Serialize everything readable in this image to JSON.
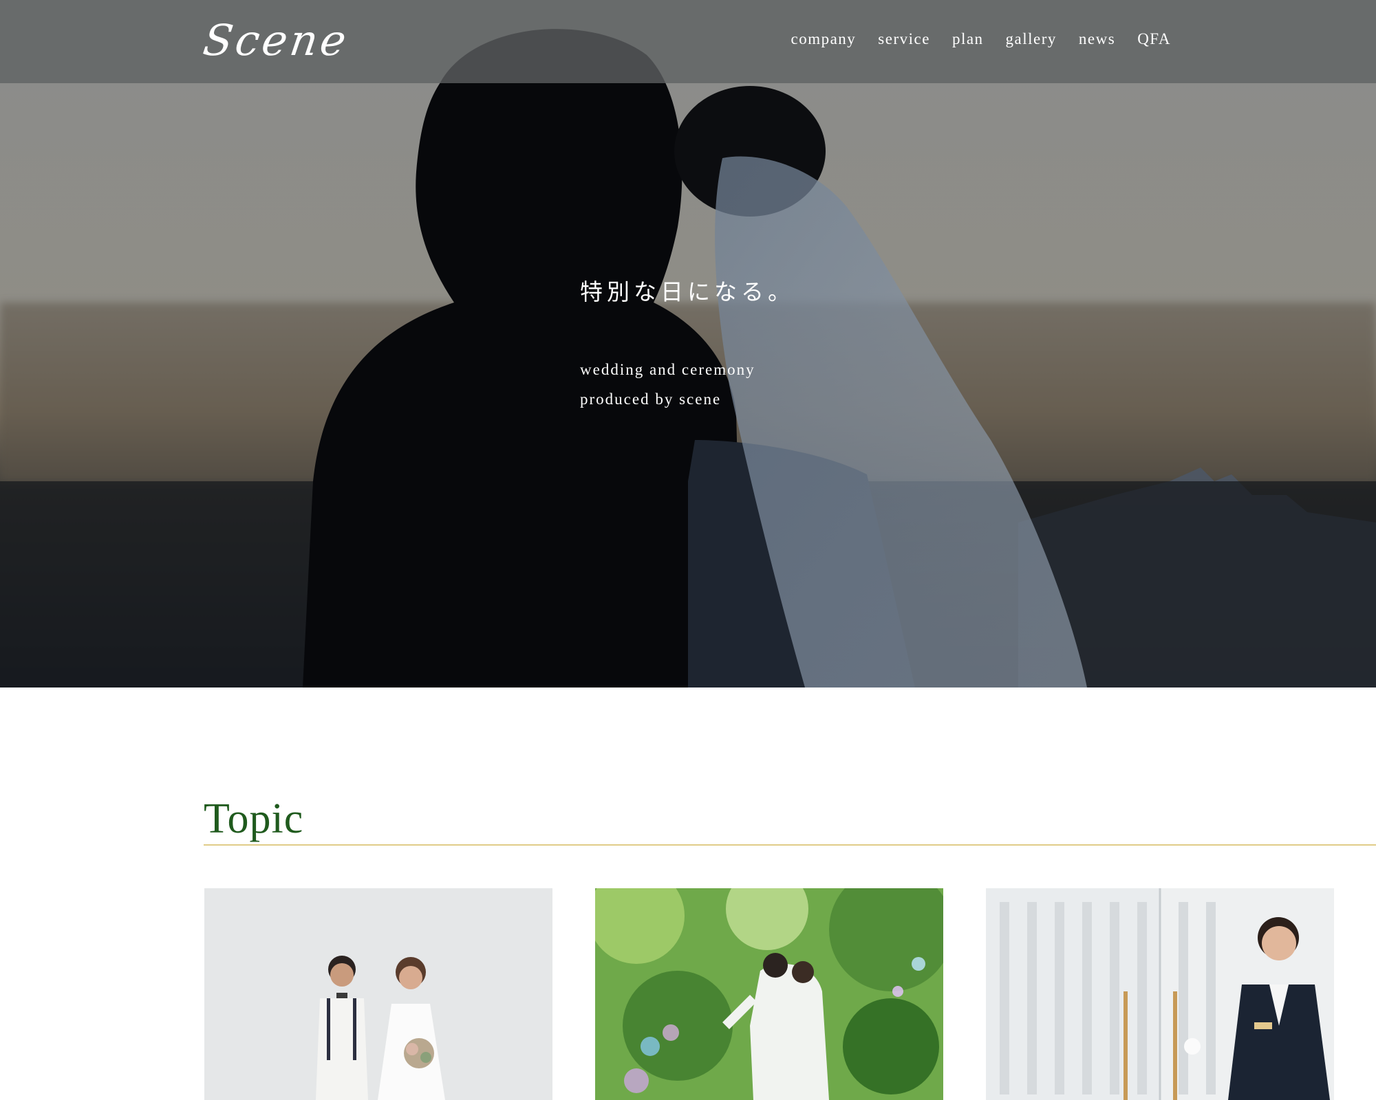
{
  "header": {
    "logo": "Scene",
    "nav": [
      "company",
      "service",
      "plan",
      "gallery",
      "news",
      "QFA"
    ]
  },
  "hero": {
    "title": "特別な日になる。",
    "subtitle_line1": "wedding and ceremony",
    "subtitle_line2": "produced by scene"
  },
  "topic": {
    "heading": "Topic"
  },
  "colors": {
    "header_bg": "#5f6163",
    "topic_heading": "#1f5a1d",
    "divider": "#e0cc88"
  }
}
